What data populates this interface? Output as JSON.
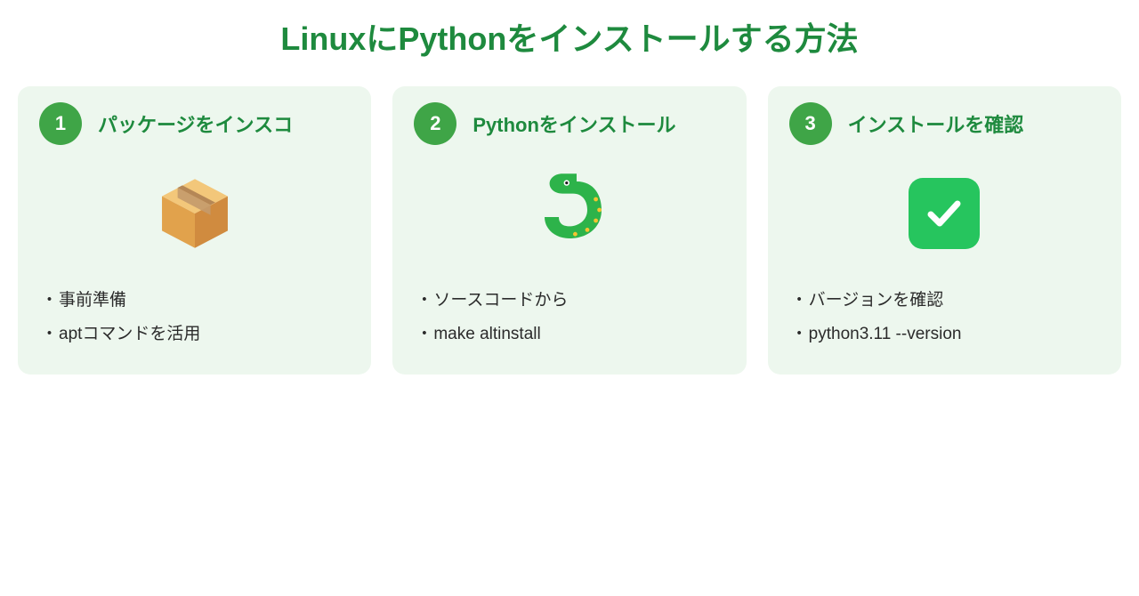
{
  "title": "LinuxにPythonをインストールする方法",
  "cards": [
    {
      "num": "1",
      "title": "パッケージをインスコ",
      "icon": "package",
      "bullets": [
        "事前準備",
        "aptコマンドを活用"
      ]
    },
    {
      "num": "2",
      "title": "Pythonをインストール",
      "icon": "snake",
      "bullets": [
        "ソースコードから",
        "make altinstall"
      ]
    },
    {
      "num": "3",
      "title": "インストールを確認",
      "icon": "checkmark",
      "bullets": [
        "バージョンを確認",
        "python3.11 --version"
      ]
    }
  ]
}
